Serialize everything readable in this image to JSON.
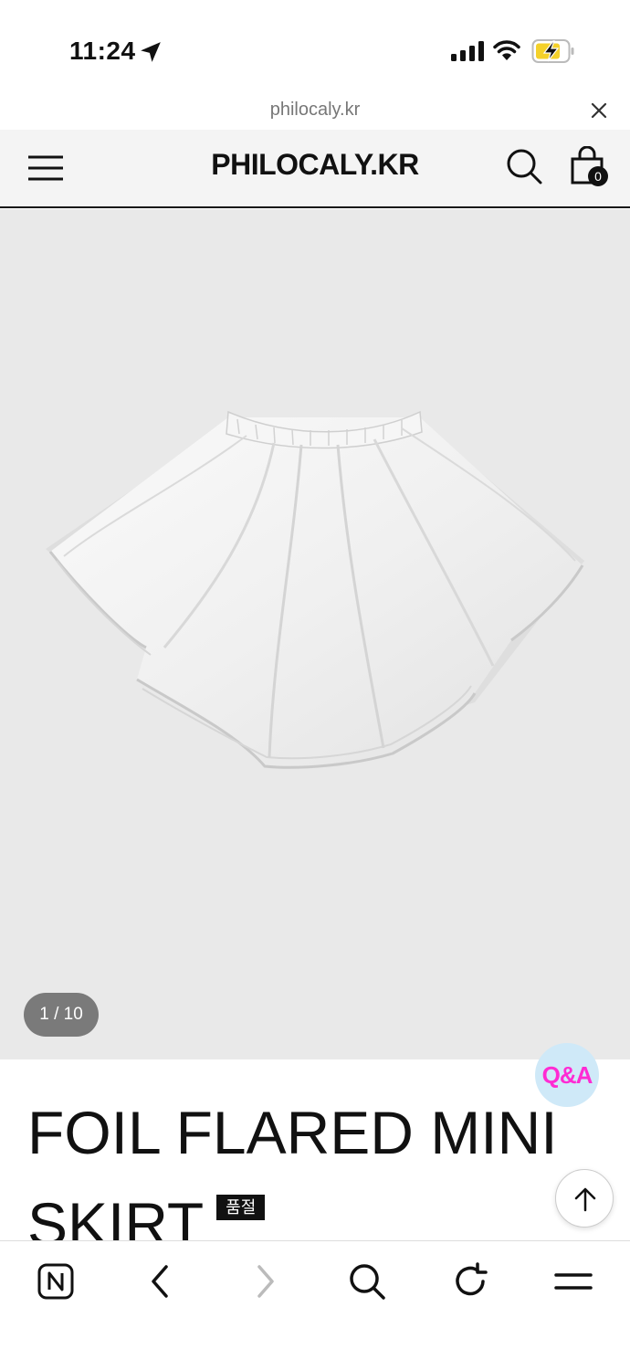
{
  "status_bar": {
    "time": "11:24",
    "icons": [
      "location-arrow-icon",
      "signal-icon",
      "wifi-icon",
      "battery-charging-icon"
    ]
  },
  "url_bar": {
    "domain": "philocaly.kr"
  },
  "header": {
    "brand": "PHILOCALY.KR",
    "cart_count": "0"
  },
  "product": {
    "image_counter": "1 / 10",
    "title": "FOIL FLARED MINI SKIRT",
    "soldout_label": "품절",
    "qa_label": "Q&A"
  },
  "bottom_bar": {
    "icons": [
      "naver-icon",
      "back-icon",
      "forward-icon",
      "search-icon",
      "refresh-icon",
      "menu-icon"
    ]
  },
  "colors": {
    "image_bg": "#e9e9e9",
    "qa_text": "#ff2bd3",
    "qa_bg": "#cfe9f8",
    "battery": "#f4d12a"
  }
}
